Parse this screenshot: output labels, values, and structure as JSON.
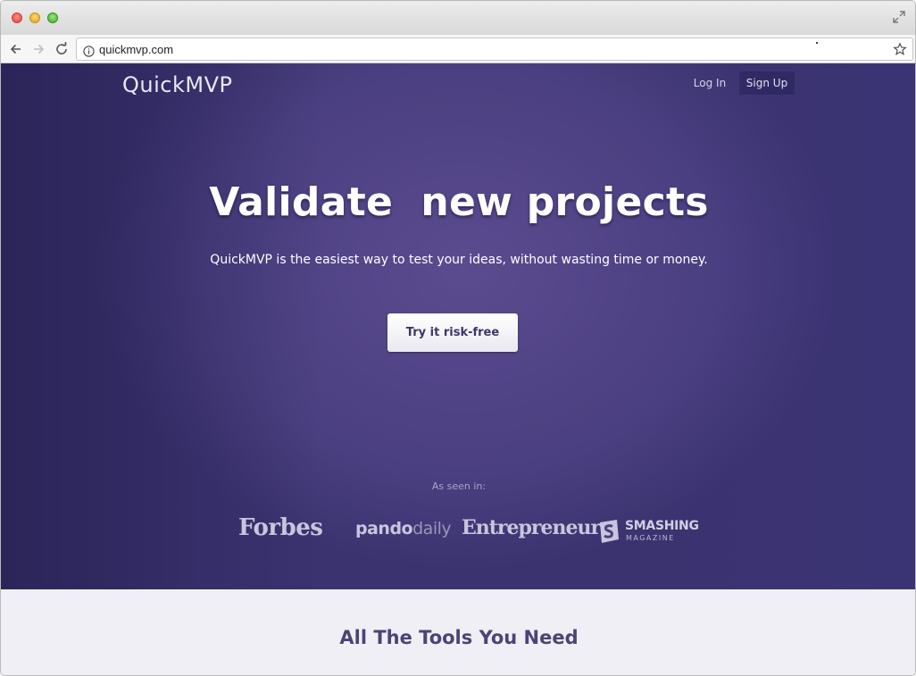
{
  "browser": {
    "url": "quickmvp.com"
  },
  "header": {
    "logo": "QuickMVP",
    "login_label": "Log In",
    "signup_label": "Sign Up"
  },
  "hero": {
    "headline": "Validate  new projects",
    "subheadline": "QuickMVP is the easiest way to test your ideas, without wasting time or money.",
    "cta_label": "Try it risk-free"
  },
  "press": {
    "label": "As seen in:",
    "forbes": "Forbes",
    "pando_strong": "pando",
    "pando_light": "daily",
    "entrepreneur": "Entrepreneur",
    "smashing_title": "SMASHING",
    "smashing_sub": "MAGAZINE"
  },
  "tools": {
    "title": "All The Tools You Need"
  },
  "colors": {
    "hero_bg": "#4a3f80",
    "cta_text": "#3e3668",
    "section_bg": "#f0eff5",
    "section_title": "#4a4476"
  },
  "icons": {
    "back": "back-arrow-icon",
    "forward": "forward-arrow-icon",
    "reload": "reload-icon",
    "info": "info-icon",
    "star": "bookmark-star-icon",
    "expand": "fullscreen-icon",
    "smashing": "smashing-s-icon"
  }
}
